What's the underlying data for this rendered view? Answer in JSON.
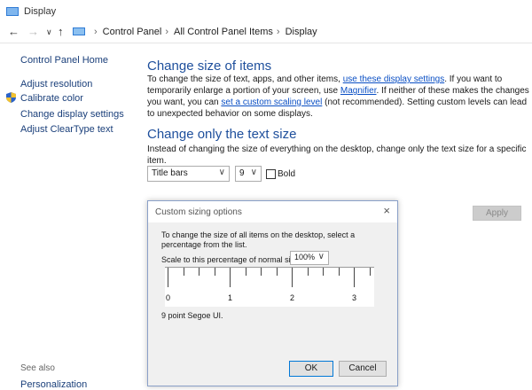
{
  "window": {
    "title": "Display"
  },
  "nav": {
    "back_icon": "arrow-left-icon",
    "forward_icon": "arrow-right-icon",
    "up_icon": "arrow-up-icon",
    "breadcrumb": [
      "Control Panel",
      "All Control Panel Items",
      "Display"
    ]
  },
  "sidebar": {
    "home": "Control Panel Home",
    "links": [
      "Adjust resolution",
      "Calibrate color",
      "Change display settings",
      "Adjust ClearType text"
    ],
    "see_also_label": "See also",
    "see_also_links": [
      "Personalization"
    ]
  },
  "section1": {
    "title": "Change size of items",
    "p1": "To change the size of text, apps, and other items,",
    "link1": "use these display settings",
    "p2": ". If you want to temporarily enlarge a portion of your screen, use",
    "link2": "Magnifier",
    "p3": ". If neither of these makes the changes you want, you can",
    "link3": "set a custom scaling level",
    "p4": "(not recommended). Setting custom levels can lead to unexpected behavior on some displays."
  },
  "section2": {
    "title": "Change only the text size",
    "desc": "Instead of changing the size of everything on the desktop, change only the text size for a specific item.",
    "item_select": "Title bars",
    "size_select": "9",
    "bold_label": "Bold",
    "bold_checked": false,
    "apply_label": "Apply"
  },
  "dialog": {
    "title": "Custom sizing options",
    "instruction": "To change the size of all items on the desktop, select a percentage from the list.",
    "scale_label": "Scale to this percentage of normal size:",
    "scale_value": "100%",
    "ruler_labels": [
      "0",
      "1",
      "2",
      "3"
    ],
    "preview_text": "9 point Segoe UI.",
    "ok_label": "OK",
    "cancel_label": "Cancel"
  }
}
